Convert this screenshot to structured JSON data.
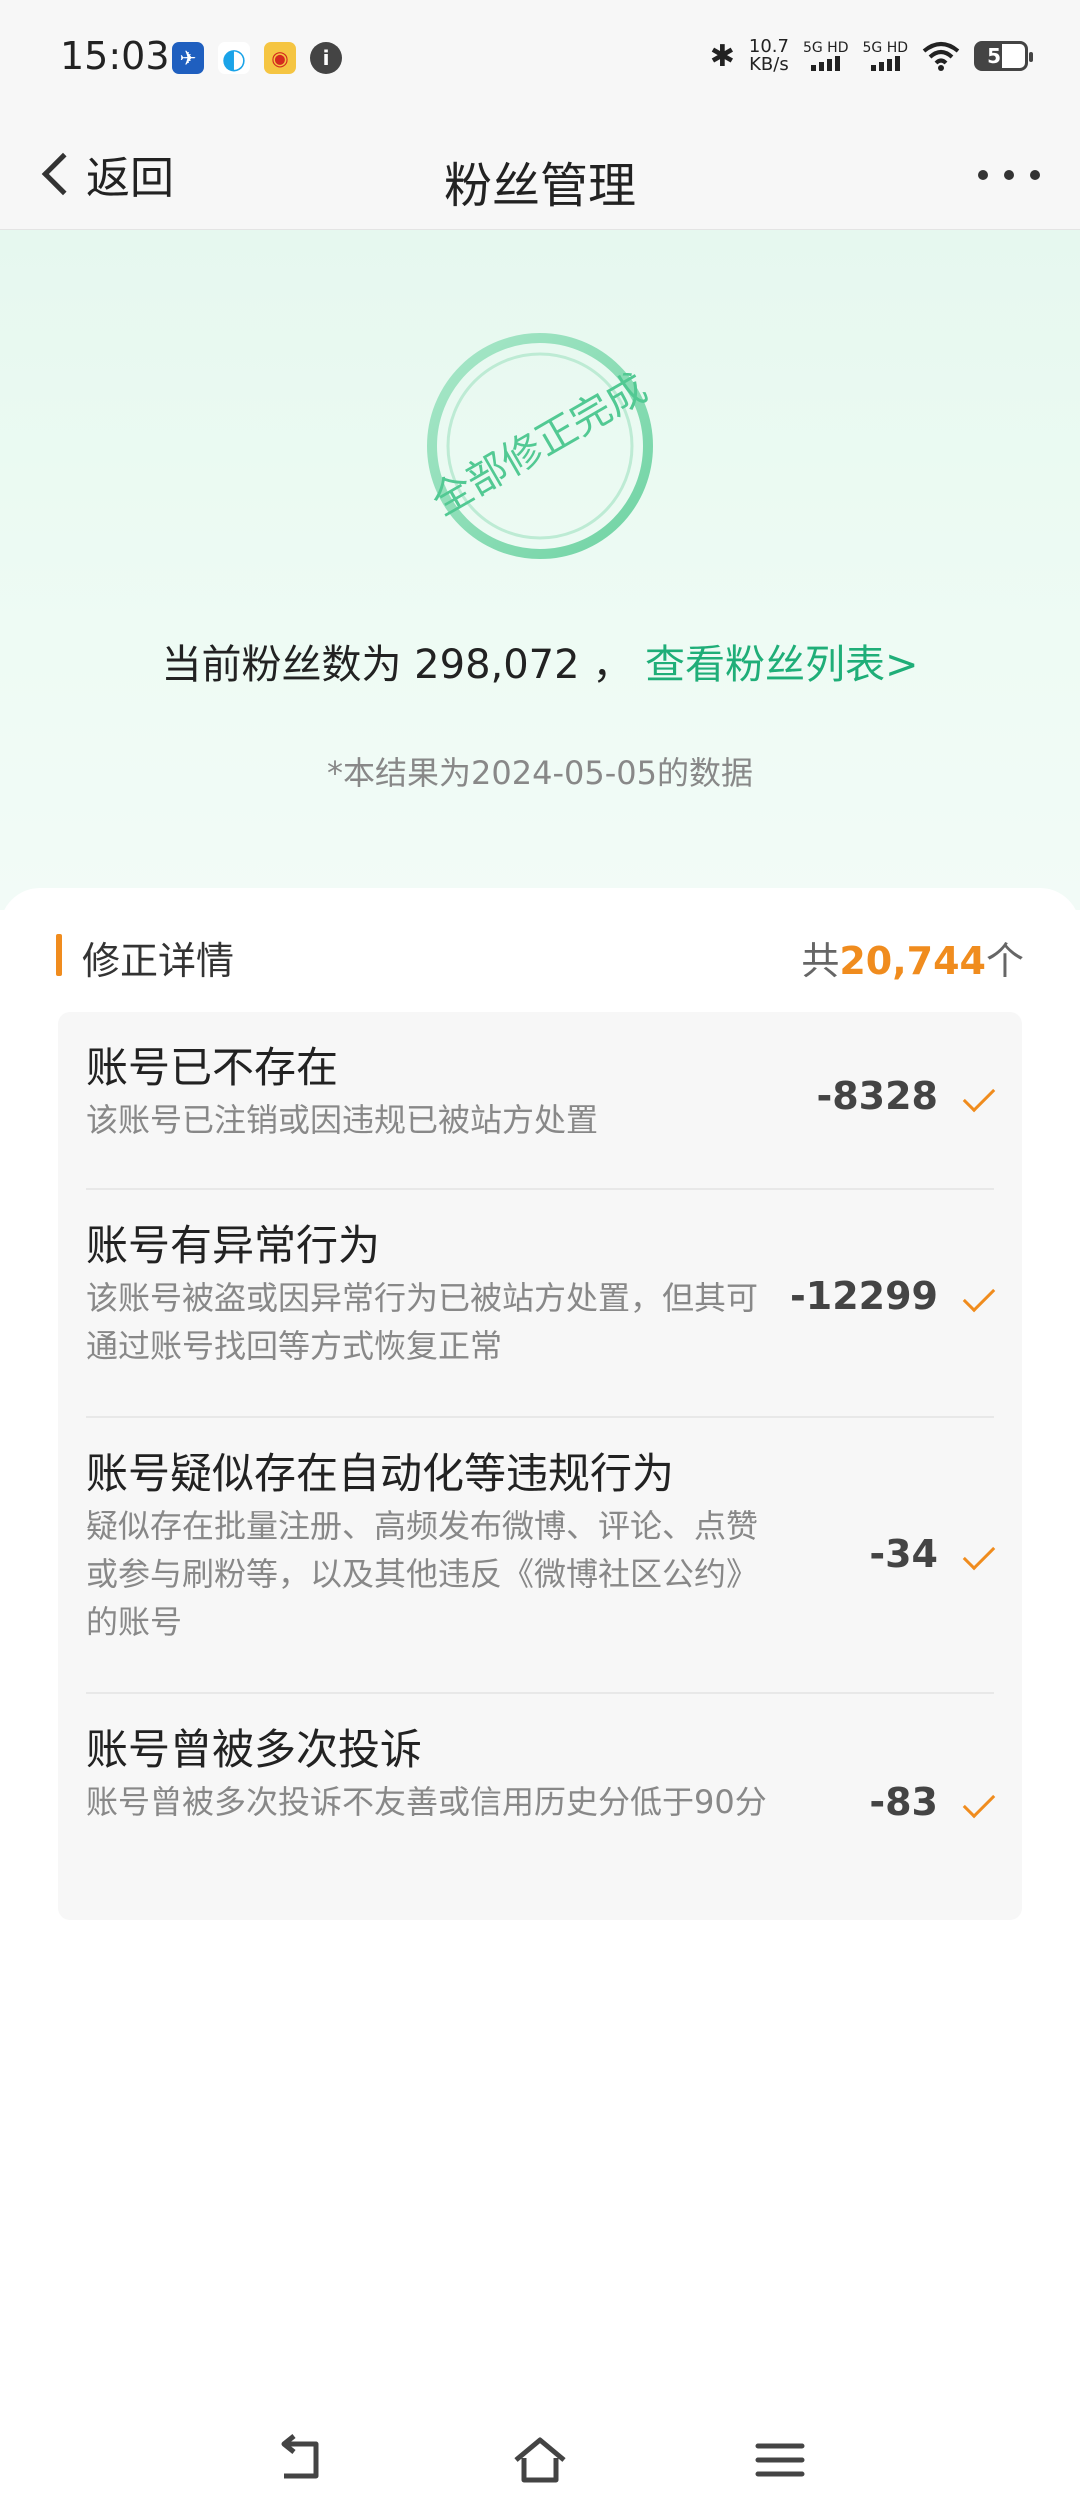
{
  "status_bar": {
    "time": "15:03",
    "net_speed_value": "10.7",
    "net_speed_unit": "KB/s",
    "signal1": "5G HD",
    "signal2": "5G HD",
    "battery": "52"
  },
  "nav": {
    "back_label": "返回",
    "title": "粉丝管理"
  },
  "hero": {
    "stamp_text": "全部修正完成",
    "fans_prefix": "当前粉丝数为",
    "fans_count": "298,072",
    "fans_separator": "，",
    "fans_link": "查看粉丝列表>",
    "date_note": "*本结果为2024-05-05的数据"
  },
  "details": {
    "section_title": "修正详情",
    "total_prefix": "共",
    "total_count": "20,744",
    "total_suffix": "个",
    "rows": [
      {
        "title": "账号已不存在",
        "desc": "该账号已注销或因违规已被站方处置",
        "value": "-8328"
      },
      {
        "title": "账号有异常行为",
        "desc": "该账号被盗或因异常行为已被站方处置，但其可通过账号找回等方式恢复正常",
        "value": "-12299"
      },
      {
        "title": "账号疑似存在自动化等违规行为",
        "desc": "疑似存在批量注册、高频发布微博、评论、点赞或参与刷粉等，以及其他违反《微博社区公约》的账号",
        "value": "-34"
      },
      {
        "title": "账号曾被多次投诉",
        "desc": "账号曾被多次投诉不友善或信用历史分低于90分",
        "value": "-83"
      }
    ]
  },
  "colors": {
    "accent_green": "#1fae78",
    "accent_orange": "#f08c1e"
  }
}
